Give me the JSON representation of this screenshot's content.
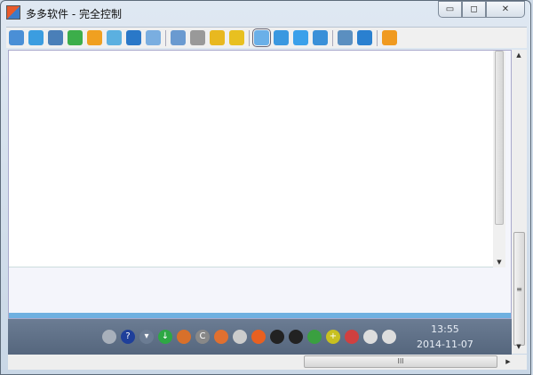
{
  "window": {
    "title": "多多软件 - 完全控制",
    "minimize": "▭",
    "maximize": "◻",
    "close": "✕"
  },
  "toolbar": {
    "icons": [
      {
        "name": "remote-screen-icon",
        "color": "#4a8fd6"
      },
      {
        "name": "window-icon",
        "color": "#3b9de0"
      },
      {
        "name": "terminal-icon",
        "color": "#4a7fb8"
      },
      {
        "name": "transfer-icon",
        "color": "#3cae4a"
      },
      {
        "name": "power-icon",
        "color": "#f0a020"
      },
      {
        "name": "chat-icon",
        "color": "#5bb0e0"
      },
      {
        "name": "phone-icon",
        "color": "#2a78c8"
      },
      {
        "name": "message-icon",
        "color": "#7aaee0"
      },
      {
        "name": "upload-icon",
        "color": "#6a9ad0"
      },
      {
        "name": "network-icon",
        "color": "#999999"
      },
      {
        "name": "download-clip-icon",
        "color": "#e8b820"
      },
      {
        "name": "upload-clip-icon",
        "color": "#e8c020"
      },
      {
        "name": "normal-view-icon",
        "color": "#6ab0e8"
      },
      {
        "name": "fit-view-icon",
        "color": "#3a98e0"
      },
      {
        "name": "fullscreen-icon",
        "color": "#3aa0ea"
      },
      {
        "name": "stretch-icon",
        "color": "#3a90d8"
      },
      {
        "name": "multi-screen-icon",
        "color": "#5b8fc0"
      },
      {
        "name": "settings-tools-icon",
        "color": "#2a80d0"
      },
      {
        "name": "disconnect-icon",
        "color": "#f09a20"
      }
    ]
  },
  "taskbar": {
    "icons": [
      {
        "name": "keyboard-icon",
        "color": "#a8b0bb"
      },
      {
        "name": "help-icon",
        "color": "#1f3f9a",
        "glyph": "?"
      },
      {
        "name": "show-hidden-icon",
        "color": "#6b7c93",
        "glyph": "▾"
      },
      {
        "name": "security-shield-icon",
        "color": "#2ea844",
        "glyph": "↓"
      },
      {
        "name": "app-icon",
        "color": "#d8702a"
      },
      {
        "name": "refresh-icon",
        "color": "#888888",
        "glyph": "C"
      },
      {
        "name": "pinwheel-icon",
        "color": "#e07030"
      },
      {
        "name": "media-icon",
        "color": "#cccccc"
      },
      {
        "name": "browser-icon",
        "color": "#e86020"
      },
      {
        "name": "qq-icon",
        "color": "#222222"
      },
      {
        "name": "qq-icon-2",
        "color": "#222222"
      },
      {
        "name": "guard-shield-icon",
        "color": "#3aa040"
      },
      {
        "name": "plus-icon",
        "color": "#c8c020",
        "glyph": "+"
      },
      {
        "name": "volume-icon",
        "color": "#d04040"
      },
      {
        "name": "speaker-icon",
        "color": "#dddddd"
      },
      {
        "name": "network-status-icon",
        "color": "#dddddd"
      }
    ],
    "time": "13:55",
    "date": "2014-11-07"
  },
  "scroll": {
    "hgrip": "III",
    "vgrip": "≡"
  }
}
